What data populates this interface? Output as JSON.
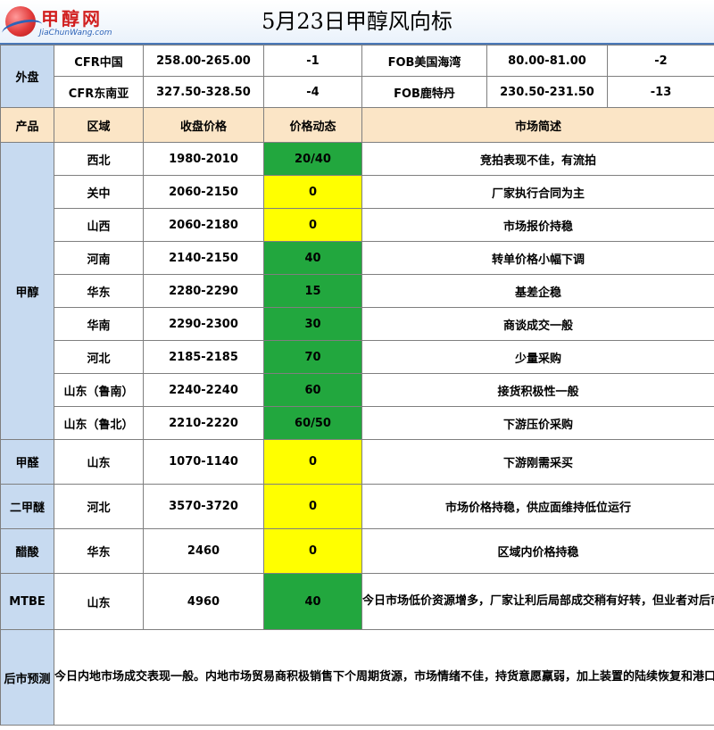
{
  "header": {
    "logo_name": "甲醇网",
    "logo_url": "JiaChunWang.com",
    "title": "5月23日甲醇风向标"
  },
  "external": {
    "label": "外盘",
    "rows": [
      {
        "name1": "CFR中国",
        "price1": "258.00-265.00",
        "chg1": "-1",
        "name2": "FOB美国海湾",
        "price2": "80.00-81.00",
        "chg2": "-2"
      },
      {
        "name1": "CFR东南亚",
        "price1": "327.50-328.50",
        "chg1": "-4",
        "name2": "FOB鹿特丹",
        "price2": "230.50-231.50",
        "chg2": "-13"
      }
    ]
  },
  "columns": {
    "product": "产品",
    "region": "区域",
    "price": "收盘价格",
    "change": "价格动态",
    "comment": "市场简述"
  },
  "products": [
    {
      "name": "甲醇",
      "rows": [
        {
          "region": "西北",
          "price": "1980-2010",
          "change": "20/40",
          "color": "#22a73e",
          "comment": "竞拍表现不佳，有流拍"
        },
        {
          "region": "关中",
          "price": "2060-2150",
          "change": "0",
          "color": "#ffff00",
          "comment": "厂家执行合同为主"
        },
        {
          "region": "山西",
          "price": "2060-2180",
          "change": "0",
          "color": "#ffff00",
          "comment": "市场报价持稳"
        },
        {
          "region": "河南",
          "price": "2140-2150",
          "change": "40",
          "color": "#22a73e",
          "comment": "转单价格小幅下调"
        },
        {
          "region": "华东",
          "price": "2280-2290",
          "change": "15",
          "color": "#22a73e",
          "comment": "基差企稳"
        },
        {
          "region": "华南",
          "price": "2290-2300",
          "change": "30",
          "color": "#22a73e",
          "comment": "商谈成交一般"
        },
        {
          "region": "河北",
          "price": "2185-2185",
          "change": "70",
          "color": "#22a73e",
          "comment": "少量采购"
        },
        {
          "region": "山东（鲁南）",
          "price": "2240-2240",
          "change": "60",
          "color": "#22a73e",
          "comment": "接货积极性一般"
        },
        {
          "region": "山东（鲁北）",
          "price": "2210-2220",
          "change": "60/50",
          "color": "#22a73e",
          "comment": "下游压价采购"
        }
      ]
    },
    {
      "name": "甲醛",
      "rows": [
        {
          "region": "山东",
          "price": "1070-1140",
          "change": "0",
          "color": "#ffff00",
          "comment": "下游刚需采买"
        }
      ]
    },
    {
      "name": "二甲醚",
      "rows": [
        {
          "region": "河北",
          "price": "3570-3720",
          "change": "0",
          "color": "#ffff00",
          "comment": "市场价格持稳，供应面维持低位运行"
        }
      ]
    },
    {
      "name": "醋酸",
      "rows": [
        {
          "region": "华东",
          "price": "2460",
          "change": "0",
          "color": "#ffff00",
          "comment": "区域内价格持稳"
        }
      ]
    },
    {
      "name": "MTBE",
      "rows": [
        {
          "region": "山东",
          "price": "4960",
          "change": "40",
          "color": "#22a73e",
          "comment": "今日市场低价资源增多，厂家让利后局部成交稍有好转，但业者对后市多存有谨慎心态，采买多维持刚需。"
        }
      ]
    }
  ],
  "forecast": {
    "label": "后市预测",
    "text": "今日内地市场成交表现一般。内地市场贸易商积极销售下个周期货源，市场情绪不佳，持货意愿羸弱，加上装置的陆续恢复和港口货源的持续到港，厂家预计节前以积极出货排库为主，需求未有明显提升，业者信心不足，对后市看空情绪较为一致。预计短期甲醇市场走势区间震荡偏弱。"
  }
}
